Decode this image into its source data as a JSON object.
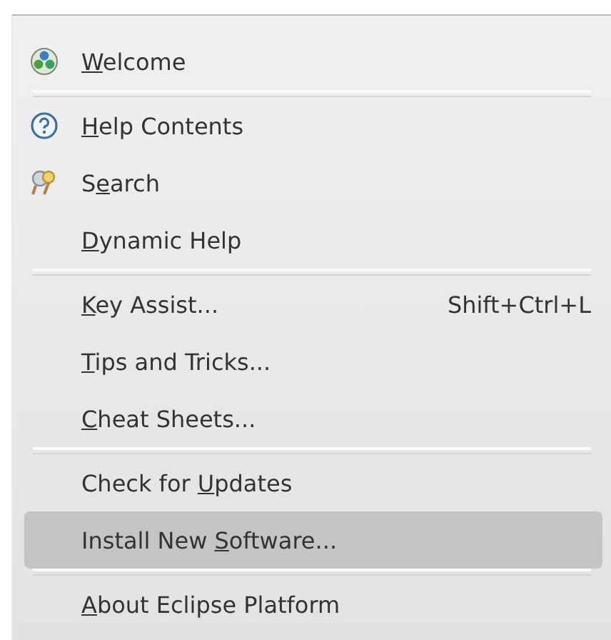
{
  "menu": {
    "items": [
      {
        "kind": "globe-item",
        "key": "W",
        "post": "elcome",
        "selected": false
      },
      {
        "kind": "separator"
      },
      {
        "kind": "help-item",
        "key": "H",
        "post": "elp Contents",
        "selected": false
      },
      {
        "kind": "search-item",
        "pre": "S",
        "key": "e",
        "post": "arch",
        "selected": false
      },
      {
        "kind": "item",
        "key": "D",
        "post": "ynamic Help",
        "selected": false
      },
      {
        "kind": "separator"
      },
      {
        "kind": "item",
        "key": "K",
        "post": "ey Assist...",
        "shortcut": "Shift+Ctrl+L",
        "selected": false
      },
      {
        "kind": "item",
        "key": "T",
        "post": "ips and Tricks...",
        "selected": false
      },
      {
        "kind": "item",
        "key": "C",
        "post": "heat Sheets...",
        "selected": false
      },
      {
        "kind": "separator"
      },
      {
        "kind": "item",
        "pre": "Check for ",
        "key": "U",
        "post": "pdates",
        "selected": false
      },
      {
        "kind": "item",
        "pre": "Install New ",
        "key": "S",
        "post": "oftware...",
        "selected": true
      },
      {
        "kind": "separator"
      },
      {
        "kind": "item",
        "key": "A",
        "post": "bout Eclipse Platform",
        "selected": false
      }
    ]
  }
}
